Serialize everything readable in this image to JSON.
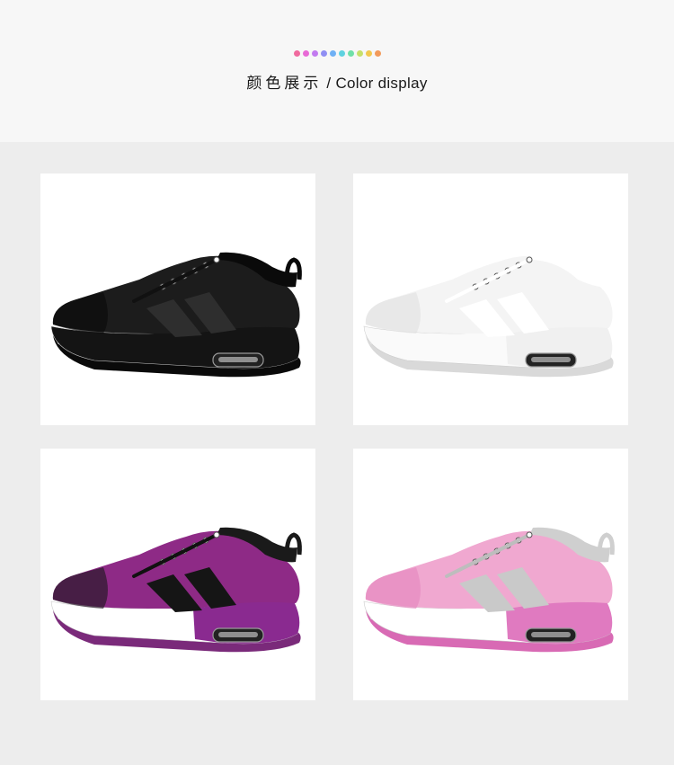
{
  "header": {
    "title_cn": "颜色展示",
    "title_sep": " / ",
    "title_en": "Color display",
    "dot_colors": [
      "#f06a9e",
      "#e86ad6",
      "#c27af0",
      "#8f8ef3",
      "#6fb0f5",
      "#5fd2e0",
      "#6fe0a8",
      "#c6e06a",
      "#f2c84f",
      "#f29a5a"
    ]
  },
  "products": [
    {
      "name": "black-sneaker",
      "upper": "#1c1c1c",
      "accent": "#0c0c0c",
      "stripe": "#2e2e2e",
      "midsole": "#141414",
      "heel": "#141414",
      "collar": "#0a0a0a",
      "laces": "#111111",
      "outsole": "#0a0a0a"
    },
    {
      "name": "white-sneaker",
      "upper": "#f4f4f4",
      "accent": "#e2e2e2",
      "stripe": "#ffffff",
      "midsole": "#fafafa",
      "heel": "#f0f0f0",
      "collar": "#ffffff",
      "laces": "#ffffff",
      "outsole": "#d9d9d9"
    },
    {
      "name": "purple-sneaker",
      "upper": "#8e2a86",
      "accent": "#2a1a2a",
      "stripe": "#151515",
      "midsole": "#ffffff",
      "heel": "#8a2a90",
      "collar": "#1a1a1a",
      "laces": "#111111",
      "outsole": "#7a2a7a"
    },
    {
      "name": "pink-sneaker",
      "upper": "#f0a8d0",
      "accent": "#e58ac0",
      "stripe": "#c9c9c9",
      "midsole": "#ffffff",
      "heel": "#e07ac0",
      "collar": "#cfcfcf",
      "laces": "#bdbdbd",
      "outsole": "#d86ab4"
    }
  ]
}
